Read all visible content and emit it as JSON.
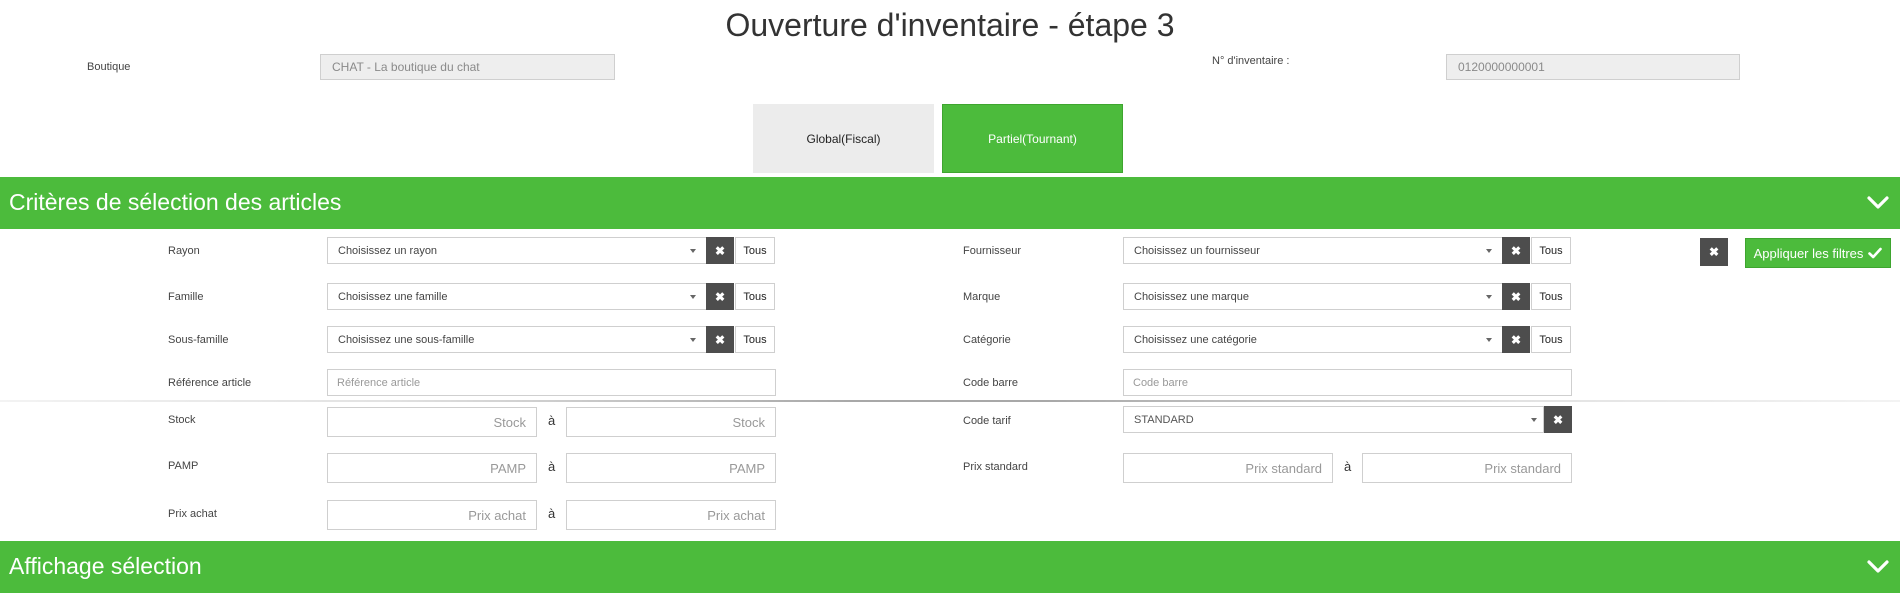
{
  "page": {
    "title": "Ouverture d'inventaire - étape 3"
  },
  "header": {
    "boutique_label": "Boutique",
    "boutique_value": "CHAT - La boutique du chat",
    "inventaire_label": "N° d'inventaire :",
    "inventaire_value": "0120000000001"
  },
  "mode": {
    "global_label": "Global(Fiscal)",
    "partial_label": "Partiel(Tournant)",
    "selected": "Partiel(Tournant)"
  },
  "colors": {
    "accent": "#4cbb3c",
    "dark_button": "#4d4d4d"
  },
  "criteria": {
    "title": "Critères de sélection des articles",
    "tous_label": "Tous",
    "to_sep": "à",
    "rayon": {
      "label": "Rayon",
      "placeholder": "Choisissez un rayon"
    },
    "famille": {
      "label": "Famille",
      "placeholder": "Choisissez une famille"
    },
    "sous_famille": {
      "label": "Sous-famille",
      "placeholder": "Choisissez une sous-famille"
    },
    "reference": {
      "label": "Référence article",
      "placeholder": "Référence article"
    },
    "fournisseur": {
      "label": "Fournisseur",
      "placeholder": "Choisissez un fournisseur"
    },
    "marque": {
      "label": "Marque",
      "placeholder": "Choisissez une marque"
    },
    "categorie": {
      "label": "Catégorie",
      "placeholder": "Choisissez une catégorie"
    },
    "code_barre": {
      "label": "Code barre",
      "placeholder": "Code barre"
    },
    "stock": {
      "label": "Stock",
      "placeholder_min": "Stock",
      "placeholder_max": "Stock"
    },
    "pamp": {
      "label": "PAMP",
      "placeholder_min": "PAMP",
      "placeholder_max": "PAMP"
    },
    "prix_achat": {
      "label": "Prix achat",
      "placeholder_min": "Prix achat",
      "placeholder_max": "Prix achat"
    },
    "code_tarif": {
      "label": "Code tarif",
      "value": "STANDARD"
    },
    "prix_standard": {
      "label": "Prix standard",
      "placeholder_min": "Prix standard",
      "placeholder_max": "Prix standard"
    },
    "apply_label": "Appliquer les filtres"
  },
  "display": {
    "title": "Affichage sélection"
  },
  "icons": {
    "clear": "close-icon",
    "chevron": "chevron-down-icon",
    "check": "check-icon",
    "caret": "caret-down-icon"
  }
}
